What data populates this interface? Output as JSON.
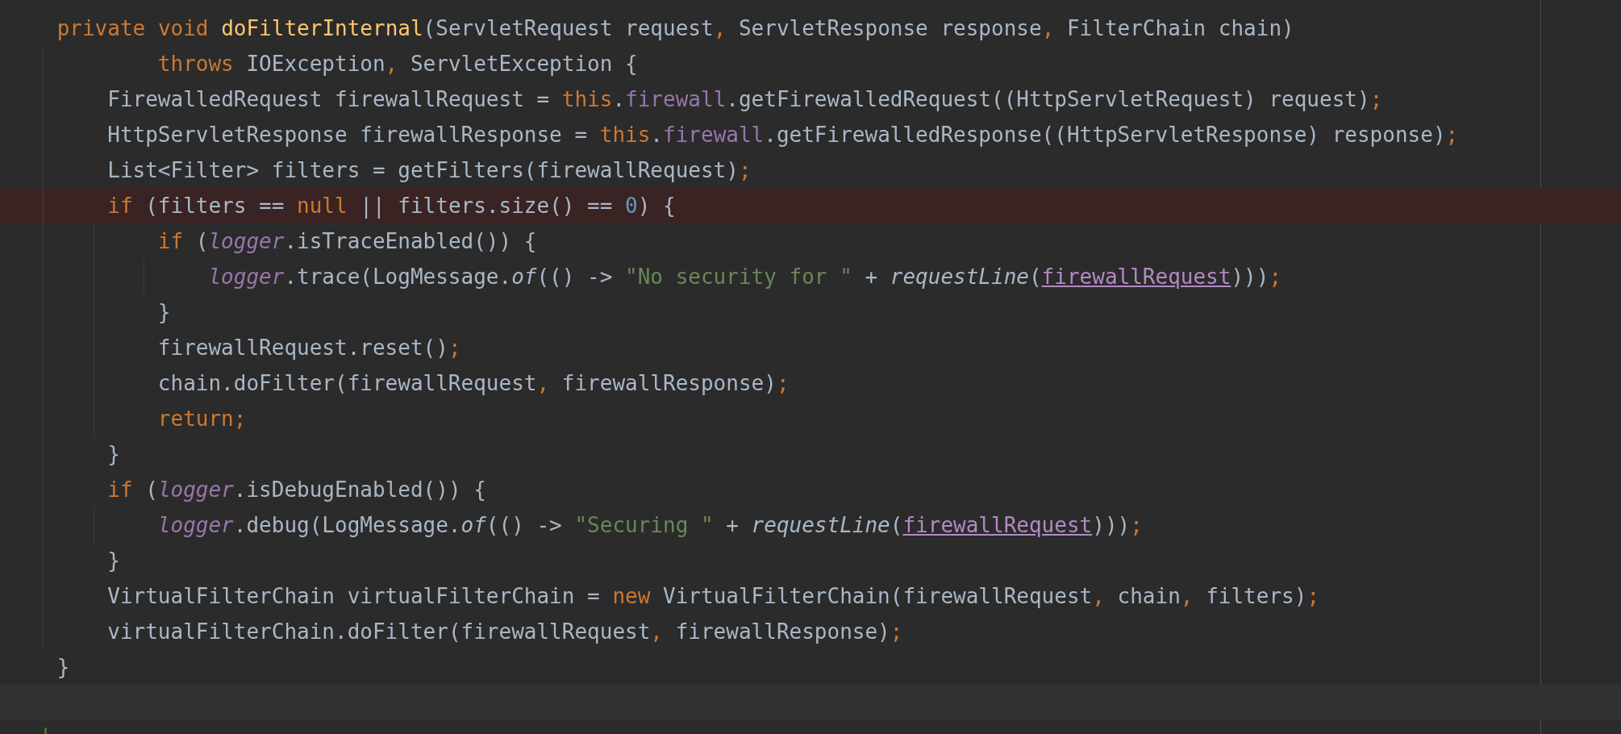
{
  "editor": {
    "lines": [
      {
        "highlighted": false,
        "current": false,
        "tokens": [
          {
            "text": "private void ",
            "kind": "keyword"
          },
          {
            "text": "doFilterInternal",
            "kind": "method"
          },
          {
            "text": "(ServletRequest request",
            "kind": "plain"
          },
          {
            "text": ", ",
            "kind": "keyword"
          },
          {
            "text": "ServletResponse response",
            "kind": "plain"
          },
          {
            "text": ", ",
            "kind": "keyword"
          },
          {
            "text": "FilterChain chain)",
            "kind": "plain"
          }
        ],
        "continuation": {
          "tokens": [
            {
              "text": "throws ",
              "kind": "keyword"
            },
            {
              "text": "IOException",
              "kind": "plain"
            },
            {
              "text": ", ",
              "kind": "keyword"
            },
            {
              "text": "ServletException {",
              "kind": "plain"
            }
          ]
        },
        "children": [
          {
            "highlighted": false,
            "current": false,
            "tokens": [
              {
                "text": "FirewalledRequest firewallRequest = ",
                "kind": "plain"
              },
              {
                "text": "this",
                "kind": "keyword"
              },
              {
                "text": ".",
                "kind": "plain"
              },
              {
                "text": "firewall",
                "kind": "field"
              },
              {
                "text": ".getFirewalledRequest((HttpServletRequest) request)",
                "kind": "plain"
              },
              {
                "text": ";",
                "kind": "keyword"
              }
            ]
          },
          {
            "highlighted": false,
            "current": false,
            "tokens": [
              {
                "text": "HttpServletResponse firewallResponse = ",
                "kind": "plain"
              },
              {
                "text": "this",
                "kind": "keyword"
              },
              {
                "text": ".",
                "kind": "plain"
              },
              {
                "text": "firewall",
                "kind": "field"
              },
              {
                "text": ".getFirewalledResponse((HttpServletResponse) response)",
                "kind": "plain"
              },
              {
                "text": ";",
                "kind": "keyword"
              }
            ]
          },
          {
            "highlighted": false,
            "current": false,
            "tokens": [
              {
                "text": "List<Filter> filters = getFilters(firewallRequest)",
                "kind": "plain"
              },
              {
                "text": ";",
                "kind": "keyword"
              }
            ]
          },
          {
            "highlighted": true,
            "current": false,
            "tokens": [
              {
                "text": "if ",
                "kind": "keyword"
              },
              {
                "text": "(filters == ",
                "kind": "plain"
              },
              {
                "text": "null ",
                "kind": "keyword"
              },
              {
                "text": "|| filters.size() == ",
                "kind": "plain"
              },
              {
                "text": "0",
                "kind": "number"
              },
              {
                "text": ") {",
                "kind": "plain"
              }
            ],
            "children": [
              {
                "highlighted": false,
                "current": false,
                "tokens": [
                  {
                    "text": "if ",
                    "kind": "keyword"
                  },
                  {
                    "text": "(",
                    "kind": "plain"
                  },
                  {
                    "text": "logger",
                    "kind": "static-field"
                  },
                  {
                    "text": ".isTraceEnabled()) {",
                    "kind": "plain"
                  }
                ],
                "children": [
                  {
                    "highlighted": false,
                    "current": false,
                    "tokens": [
                      {
                        "text": "logger",
                        "kind": "static-field"
                      },
                      {
                        "text": ".trace(LogMessage.",
                        "kind": "plain"
                      },
                      {
                        "text": "of",
                        "kind": "italic"
                      },
                      {
                        "text": "(() -> ",
                        "kind": "plain"
                      },
                      {
                        "text": "\"No security for \"",
                        "kind": "string"
                      },
                      {
                        "text": " + ",
                        "kind": "plain"
                      },
                      {
                        "text": "requestLine",
                        "kind": "italic"
                      },
                      {
                        "text": "(",
                        "kind": "plain"
                      },
                      {
                        "text": "firewallRequest",
                        "kind": "captured"
                      },
                      {
                        "text": ")))",
                        "kind": "plain"
                      },
                      {
                        "text": ";",
                        "kind": "keyword"
                      }
                    ]
                  }
                ]
              },
              {
                "highlighted": false,
                "current": false,
                "tokens": [
                  {
                    "text": "}",
                    "kind": "plain"
                  }
                ]
              },
              {
                "highlighted": false,
                "current": false,
                "tokens": [
                  {
                    "text": "firewallRequest.reset()",
                    "kind": "plain"
                  },
                  {
                    "text": ";",
                    "kind": "keyword"
                  }
                ]
              },
              {
                "highlighted": false,
                "current": false,
                "tokens": [
                  {
                    "text": "chain.doFilter(firewallRequest",
                    "kind": "plain"
                  },
                  {
                    "text": ", ",
                    "kind": "keyword"
                  },
                  {
                    "text": "firewallResponse)",
                    "kind": "plain"
                  },
                  {
                    "text": ";",
                    "kind": "keyword"
                  }
                ]
              },
              {
                "highlighted": false,
                "current": false,
                "tokens": [
                  {
                    "text": "return;",
                    "kind": "keyword"
                  }
                ]
              }
            ]
          },
          {
            "highlighted": false,
            "current": false,
            "tokens": [
              {
                "text": "}",
                "kind": "plain"
              }
            ]
          },
          {
            "highlighted": false,
            "current": false,
            "tokens": [
              {
                "text": "if ",
                "kind": "keyword"
              },
              {
                "text": "(",
                "kind": "plain"
              },
              {
                "text": "logger",
                "kind": "static-field"
              },
              {
                "text": ".isDebugEnabled()) {",
                "kind": "plain"
              }
            ],
            "children": [
              {
                "highlighted": false,
                "current": false,
                "tokens": [
                  {
                    "text": "logger",
                    "kind": "static-field"
                  },
                  {
                    "text": ".debug(LogMessage.",
                    "kind": "plain"
                  },
                  {
                    "text": "of",
                    "kind": "italic"
                  },
                  {
                    "text": "(() -> ",
                    "kind": "plain"
                  },
                  {
                    "text": "\"Securing \"",
                    "kind": "string"
                  },
                  {
                    "text": " + ",
                    "kind": "plain"
                  },
                  {
                    "text": "requestLine",
                    "kind": "italic"
                  },
                  {
                    "text": "(",
                    "kind": "plain"
                  },
                  {
                    "text": "firewallRequest",
                    "kind": "captured"
                  },
                  {
                    "text": ")))",
                    "kind": "plain"
                  },
                  {
                    "text": ";",
                    "kind": "keyword"
                  }
                ]
              }
            ]
          },
          {
            "highlighted": false,
            "current": false,
            "tokens": [
              {
                "text": "}",
                "kind": "plain"
              }
            ]
          },
          {
            "highlighted": false,
            "current": false,
            "tokens": [
              {
                "text": "VirtualFilterChain virtualFilterChain = ",
                "kind": "plain"
              },
              {
                "text": "new ",
                "kind": "keyword"
              },
              {
                "text": "VirtualFilterChain(firewallRequest",
                "kind": "plain"
              },
              {
                "text": ", ",
                "kind": "keyword"
              },
              {
                "text": "chain",
                "kind": "plain"
              },
              {
                "text": ", ",
                "kind": "keyword"
              },
              {
                "text": "filters)",
                "kind": "plain"
              },
              {
                "text": ";",
                "kind": "keyword"
              }
            ]
          },
          {
            "highlighted": false,
            "current": false,
            "tokens": [
              {
                "text": "virtualFilterChain.doFilter(firewallRequest",
                "kind": "plain"
              },
              {
                "text": ", ",
                "kind": "keyword"
              },
              {
                "text": "firewallResponse)",
                "kind": "plain"
              },
              {
                "text": ";",
                "kind": "keyword"
              }
            ]
          }
        ]
      },
      {
        "highlighted": false,
        "current": false,
        "tokens": [
          {
            "text": "}",
            "kind": "plain"
          }
        ]
      },
      {
        "highlighted": false,
        "current": true
      }
    ]
  }
}
